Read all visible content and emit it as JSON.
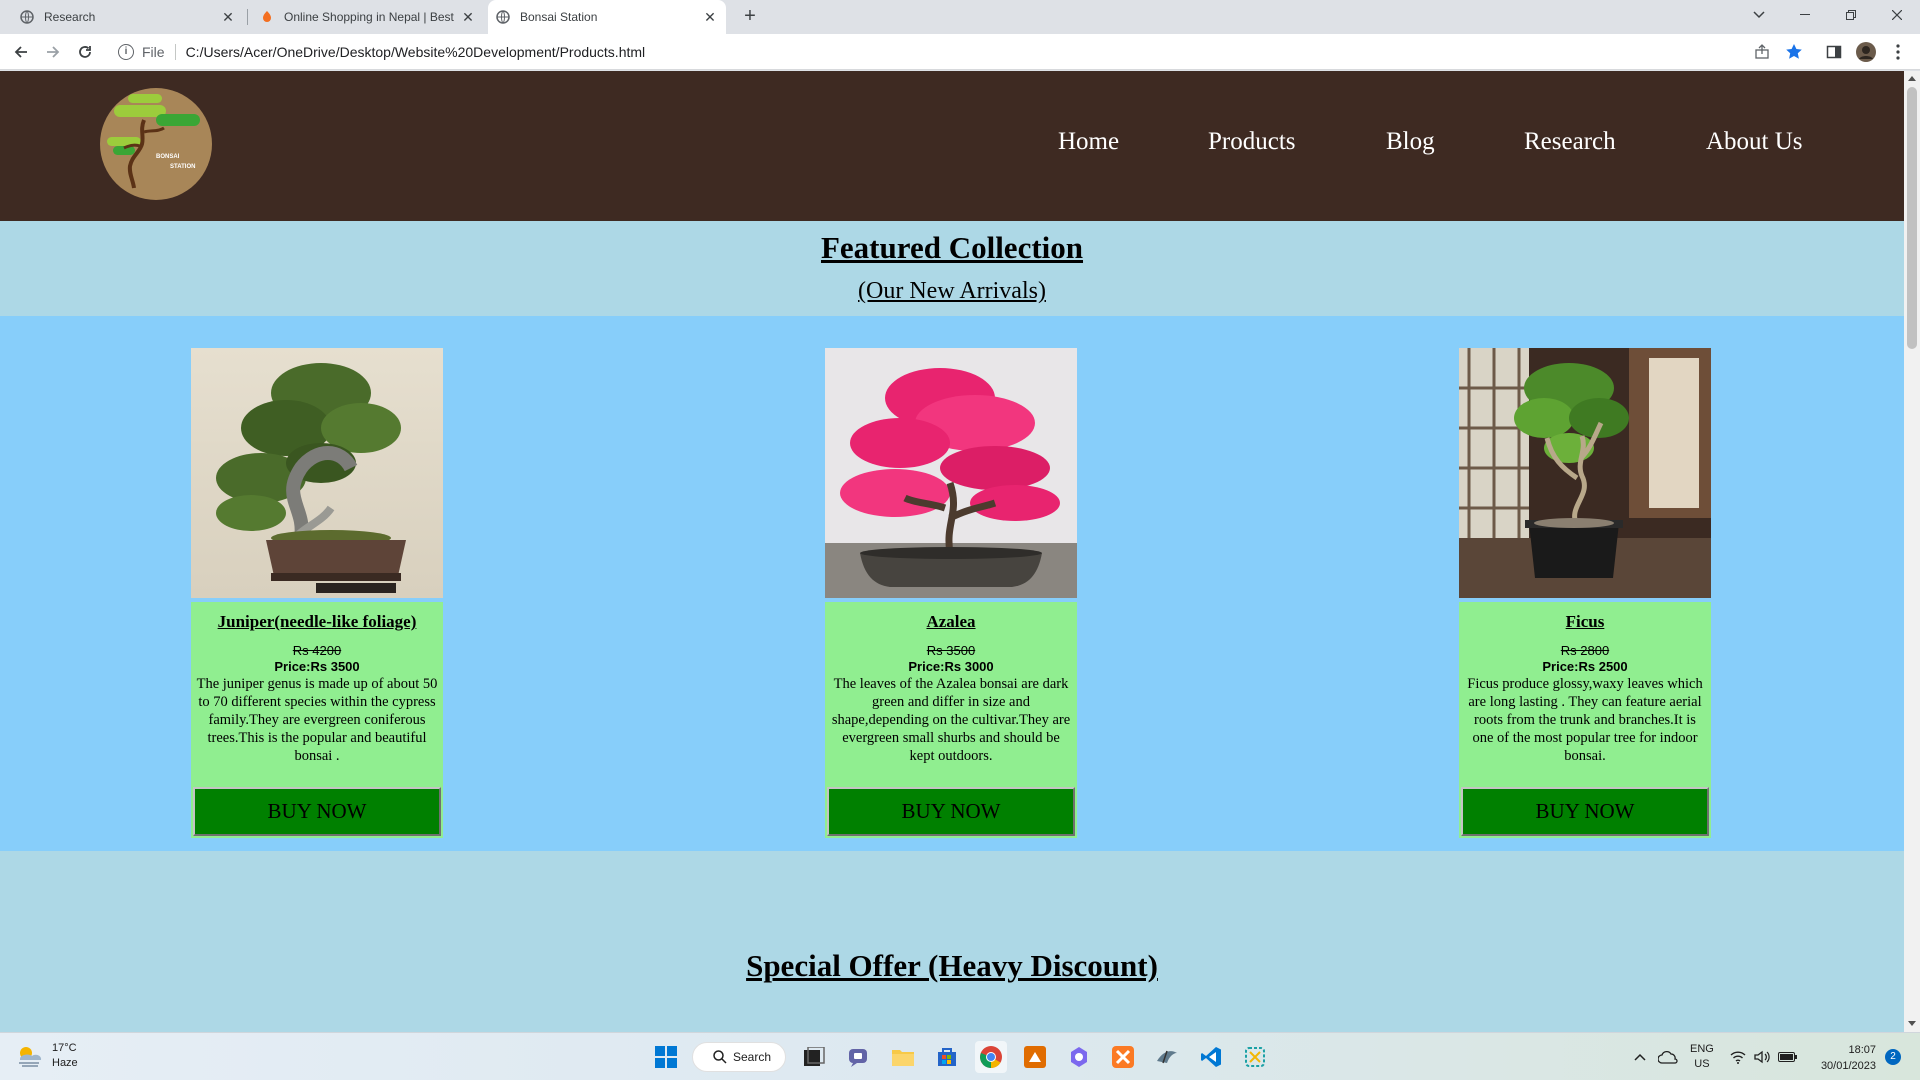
{
  "browser": {
    "tabs": [
      {
        "title": "Research",
        "active": false
      },
      {
        "title": "Online Shopping in Nepal | Best",
        "active": false
      },
      {
        "title": "Bonsai Station",
        "active": true
      }
    ],
    "new_tab_label": "+",
    "address": {
      "scheme": "File",
      "url": "C:/Users/Acer/OneDrive/Desktop/Website%20Development/Products.html"
    }
  },
  "site": {
    "logo_text": [
      "BONSAI",
      "STATION"
    ],
    "nav": [
      "Home",
      "Products",
      "Blog",
      "Research",
      "About Us"
    ],
    "featured": {
      "title": "Featured Collection",
      "subtitle": "(Our New Arrivals)"
    },
    "products": [
      {
        "name": "Juniper(needle-like foliage)",
        "old_price": "Rs 4200",
        "price": "Price:Rs 3500",
        "description": "The juniper genus is made up of about 50 to 70 different species within the cypress family.They are evergreen coniferous trees.This is the popular and beautiful bonsai .",
        "button": "BUY NOW"
      },
      {
        "name": "Azalea",
        "old_price": "Rs 3500",
        "price": "Price:Rs 3000",
        "description": "The leaves of the Azalea bonsai are dark green and differ in size and shape,depending on the cultivar.They are evergreen small shurbs and should be kept outdoors.",
        "button": "BUY NOW"
      },
      {
        "name": "Ficus",
        "old_price": "Rs 2800",
        "price": "Price:Rs 2500",
        "description": "Ficus produce glossy,waxy leaves which are long lasting . They can feature aerial roots from the trunk and branches.It is one of the most popular tree for indoor bonsai.",
        "button": "BUY NOW"
      }
    ],
    "special": {
      "title": "Special Offer (Heavy Discount)"
    }
  },
  "taskbar": {
    "weather": {
      "temp": "17°C",
      "condition": "Haze"
    },
    "search_label": "Search",
    "language": {
      "lang": "ENG",
      "region": "US"
    },
    "time": "18:07",
    "date": "30/01/2023",
    "notifications": "2"
  },
  "colors": {
    "header_bg": "#3e2a22",
    "page_bg": "#add8e6",
    "products_bg": "#87cefa",
    "card_bg": "#90ee90",
    "button_bg": "#008000"
  }
}
